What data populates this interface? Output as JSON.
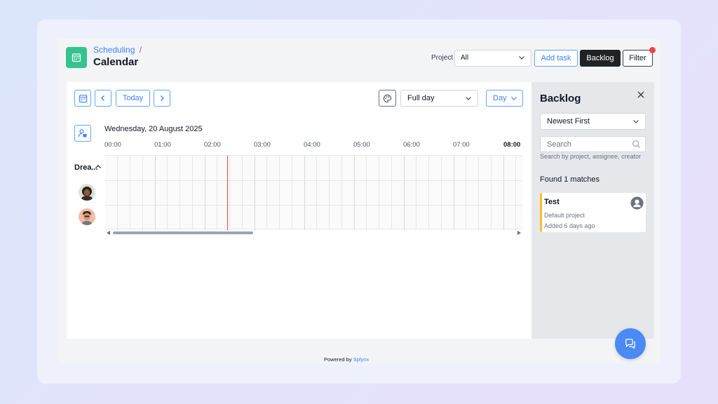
{
  "header": {
    "breadcrumb": "Scheduling",
    "breadcrumb_sep": "/",
    "title": "Calendar",
    "project_label": "Project",
    "project_value": "All",
    "add_task": "Add task",
    "backlog": "Backlog",
    "filter": "Filter"
  },
  "toolbar": {
    "today": "Today",
    "range_value": "Full day",
    "view_value": "Day"
  },
  "timeline": {
    "date": "Wednesday, 20 August 2025",
    "hours": [
      "00:00",
      "01:00",
      "02:00",
      "03:00",
      "04:00",
      "05:00",
      "06:00",
      "07:00",
      "08:00"
    ],
    "group_label": "Drea...",
    "current_time": "02:20"
  },
  "backlog": {
    "title": "Backlog",
    "sort_value": "Newest First",
    "search_placeholder": "Search",
    "search_hint": "Search by project, assignee, creator",
    "found": "Found 1 matches",
    "tasks": [
      {
        "title": "Test",
        "project": "Default project",
        "added": "Added 6 days ago"
      }
    ]
  },
  "footer": {
    "powered_prefix": "Powered by",
    "powered_brand": "Splynx"
  },
  "colors": {
    "accent": "#3b82f6",
    "app_icon": "#34c38f",
    "now_line": "#ef4444",
    "task_border": "#fbbf24",
    "chat_fab": "#4a8af4"
  }
}
